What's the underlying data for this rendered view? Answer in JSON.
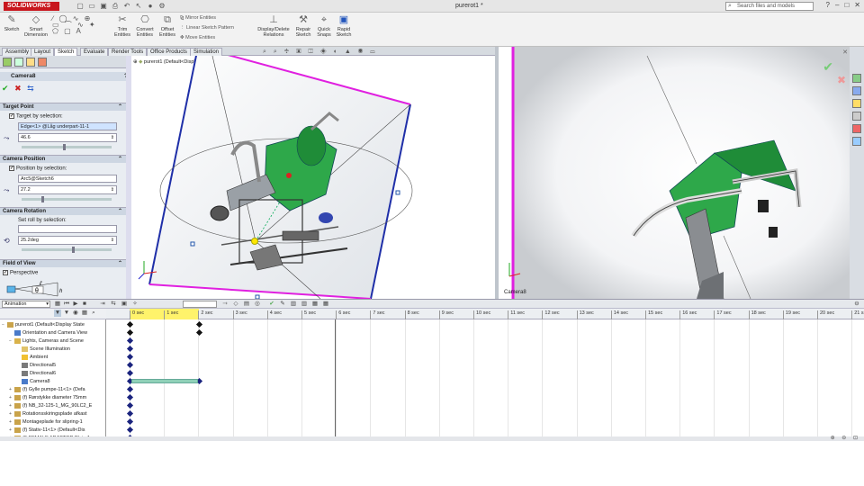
{
  "app": {
    "logo_text": "SOLIDWORKS",
    "doc_title": "purerot1 *"
  },
  "search": {
    "placeholder": "Search files and models"
  },
  "window_controls": [
    "?",
    "–",
    "□",
    "✕"
  ],
  "ribbon": {
    "large": [
      {
        "label": "Sketch",
        "icon": "sketch-icon"
      },
      {
        "label": "Smart Dimension",
        "icon": "smart-dimension-icon"
      },
      {
        "label": "Trim Entities",
        "icon": "trim-icon"
      },
      {
        "label": "Convert Entities",
        "icon": "convert-icon"
      },
      {
        "label": "Offset Entities",
        "icon": "offset-icon"
      },
      {
        "label": "Display/Delete Relations",
        "icon": "relations-icon"
      },
      {
        "label": "Repair Sketch",
        "icon": "repair-icon"
      },
      {
        "label": "Quick Snaps",
        "icon": "snaps-icon"
      },
      {
        "label": "Rapid Sketch",
        "icon": "rapid-sketch-icon"
      }
    ],
    "small": [
      "Mirror Entities",
      "Linear Sketch Pattern",
      "Move Entities"
    ]
  },
  "tabs": [
    "Assembly",
    "Layout",
    "Sketch",
    "Evaluate",
    "Render Tools",
    "Office Products",
    "Simulation"
  ],
  "active_tab": "Sketch",
  "property_manager": {
    "title": "Camera8",
    "help": "?",
    "target_point": {
      "header": "Target Point",
      "checkbox": "Target by selection:",
      "selection": "Edge<1> @Låg underpart-11-1",
      "value": "46.6"
    },
    "camera_position": {
      "header": "Camera Position",
      "checkbox": "Position by selection:",
      "selection": "Arc5@Sketch6",
      "value": "27.2"
    },
    "camera_rotation": {
      "header": "Camera Rotation",
      "label": "Set roll by selection:",
      "selection": "",
      "value": "25.2deg"
    },
    "field_of_view": {
      "header": "Field of View",
      "checkbox": "Perspective",
      "symbols": [
        "ℓ",
        "θ",
        "h"
      ]
    }
  },
  "viewport": {
    "tree_label": "purerot1 (Default<Display",
    "camera_label": "Camera8"
  },
  "motion": {
    "study_type": "Animation",
    "time_ruler": [
      "0 sec",
      "1 sec",
      "2 sec",
      "3 sec",
      "4 sec",
      "5 sec",
      "6 sec",
      "7 sec",
      "8 sec",
      "9 sec",
      "10 sec",
      "11 sec",
      "12 sec",
      "13 sec",
      "14 sec",
      "15 sec",
      "16 sec",
      "17 sec",
      "18 sec",
      "19 sec",
      "20 sec",
      "21 s"
    ],
    "tree": [
      {
        "label": "purerot1 (Default<Display State",
        "level": 0,
        "expand": "−"
      },
      {
        "label": "Orientation and Camera View",
        "level": 1,
        "expand": ""
      },
      {
        "label": "Lights, Cameras and Scene",
        "level": 1,
        "expand": "−"
      },
      {
        "label": "Scene Illumination",
        "level": 2,
        "expand": ""
      },
      {
        "label": "Ambient",
        "level": 2,
        "expand": ""
      },
      {
        "label": "Directional5",
        "level": 2,
        "expand": ""
      },
      {
        "label": "Directional6",
        "level": 2,
        "expand": ""
      },
      {
        "label": "Camera8",
        "level": 2,
        "expand": ""
      },
      {
        "label": "(f) Gylle pumpe-11<1> (Defa",
        "level": 1,
        "expand": "+"
      },
      {
        "label": "(f) Rørstykke diameter 75mm",
        "level": 1,
        "expand": "+"
      },
      {
        "label": "(f) NB_32-125-1_MG_90LC2_E",
        "level": 1,
        "expand": "+"
      },
      {
        "label": "Rotationsskiringsplade afkast",
        "level": 1,
        "expand": "+"
      },
      {
        "label": "Montageplade for slipring-1",
        "level": 1,
        "expand": "+"
      },
      {
        "label": "(f) Stativ-11<1> (Default<Dis",
        "level": 1,
        "expand": "+"
      },
      {
        "label": "(f) FEMALE ADAPTOR Plain-1",
        "level": 1,
        "expand": "+"
      }
    ]
  },
  "colors": {
    "tank_green": "#2ea84a",
    "frame_blue": "#1f2fa8",
    "frame_magenta": "#e020e0",
    "timeline_highlight": "#fff36b",
    "keyframe": "#1a237e",
    "camera_bar": "#8fd0b8"
  }
}
